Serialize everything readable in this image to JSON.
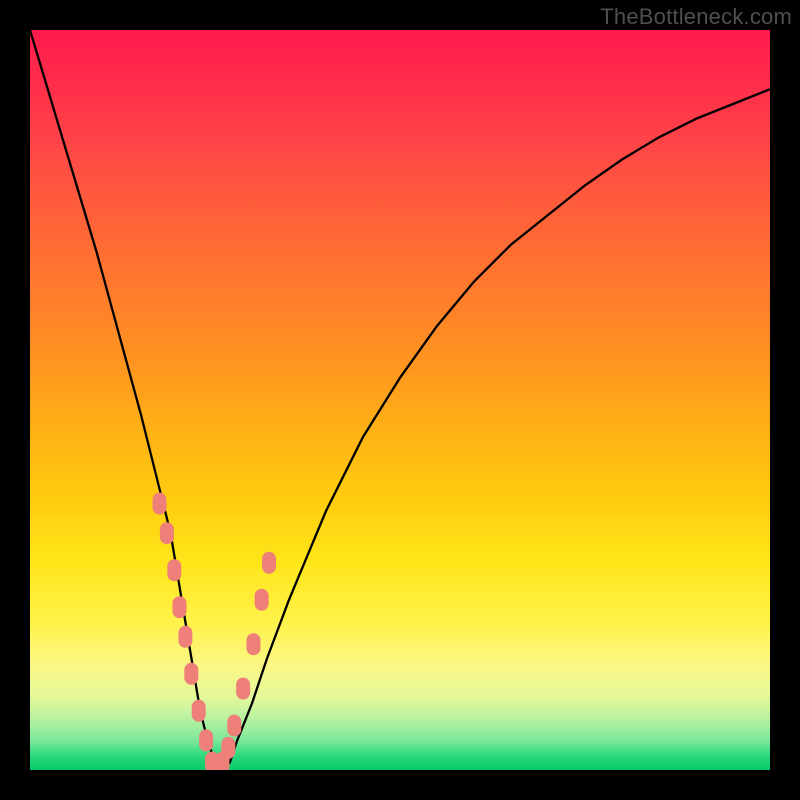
{
  "attribution": "TheBottleneck.com",
  "chart_data": {
    "type": "line",
    "title": "",
    "xlabel": "",
    "ylabel": "",
    "xlim": [
      0,
      100
    ],
    "ylim": [
      0,
      100
    ],
    "x": [
      0,
      3,
      6,
      9,
      12,
      15,
      17,
      19,
      20,
      21,
      22,
      23,
      24,
      25,
      26,
      27,
      28,
      30,
      32,
      35,
      40,
      45,
      50,
      55,
      60,
      65,
      70,
      75,
      80,
      85,
      90,
      95,
      100
    ],
    "y": [
      100,
      90,
      80,
      70,
      59,
      48,
      40,
      32,
      26,
      20,
      14,
      8,
      4,
      1,
      0,
      1,
      4,
      9,
      15,
      23,
      35,
      45,
      53,
      60,
      66,
      71,
      75,
      79,
      82.5,
      85.5,
      88,
      90,
      92
    ],
    "markers": {
      "x": [
        17.5,
        18.5,
        19.5,
        20.2,
        21.0,
        21.8,
        22.8,
        23.8,
        24.6,
        25.2,
        26.0,
        26.8,
        27.6,
        28.8,
        30.2,
        31.3,
        32.3
      ],
      "y": [
        36,
        32,
        27,
        22,
        18,
        13,
        8,
        4,
        1,
        0,
        1,
        3,
        6,
        11,
        17,
        23,
        28
      ]
    }
  }
}
